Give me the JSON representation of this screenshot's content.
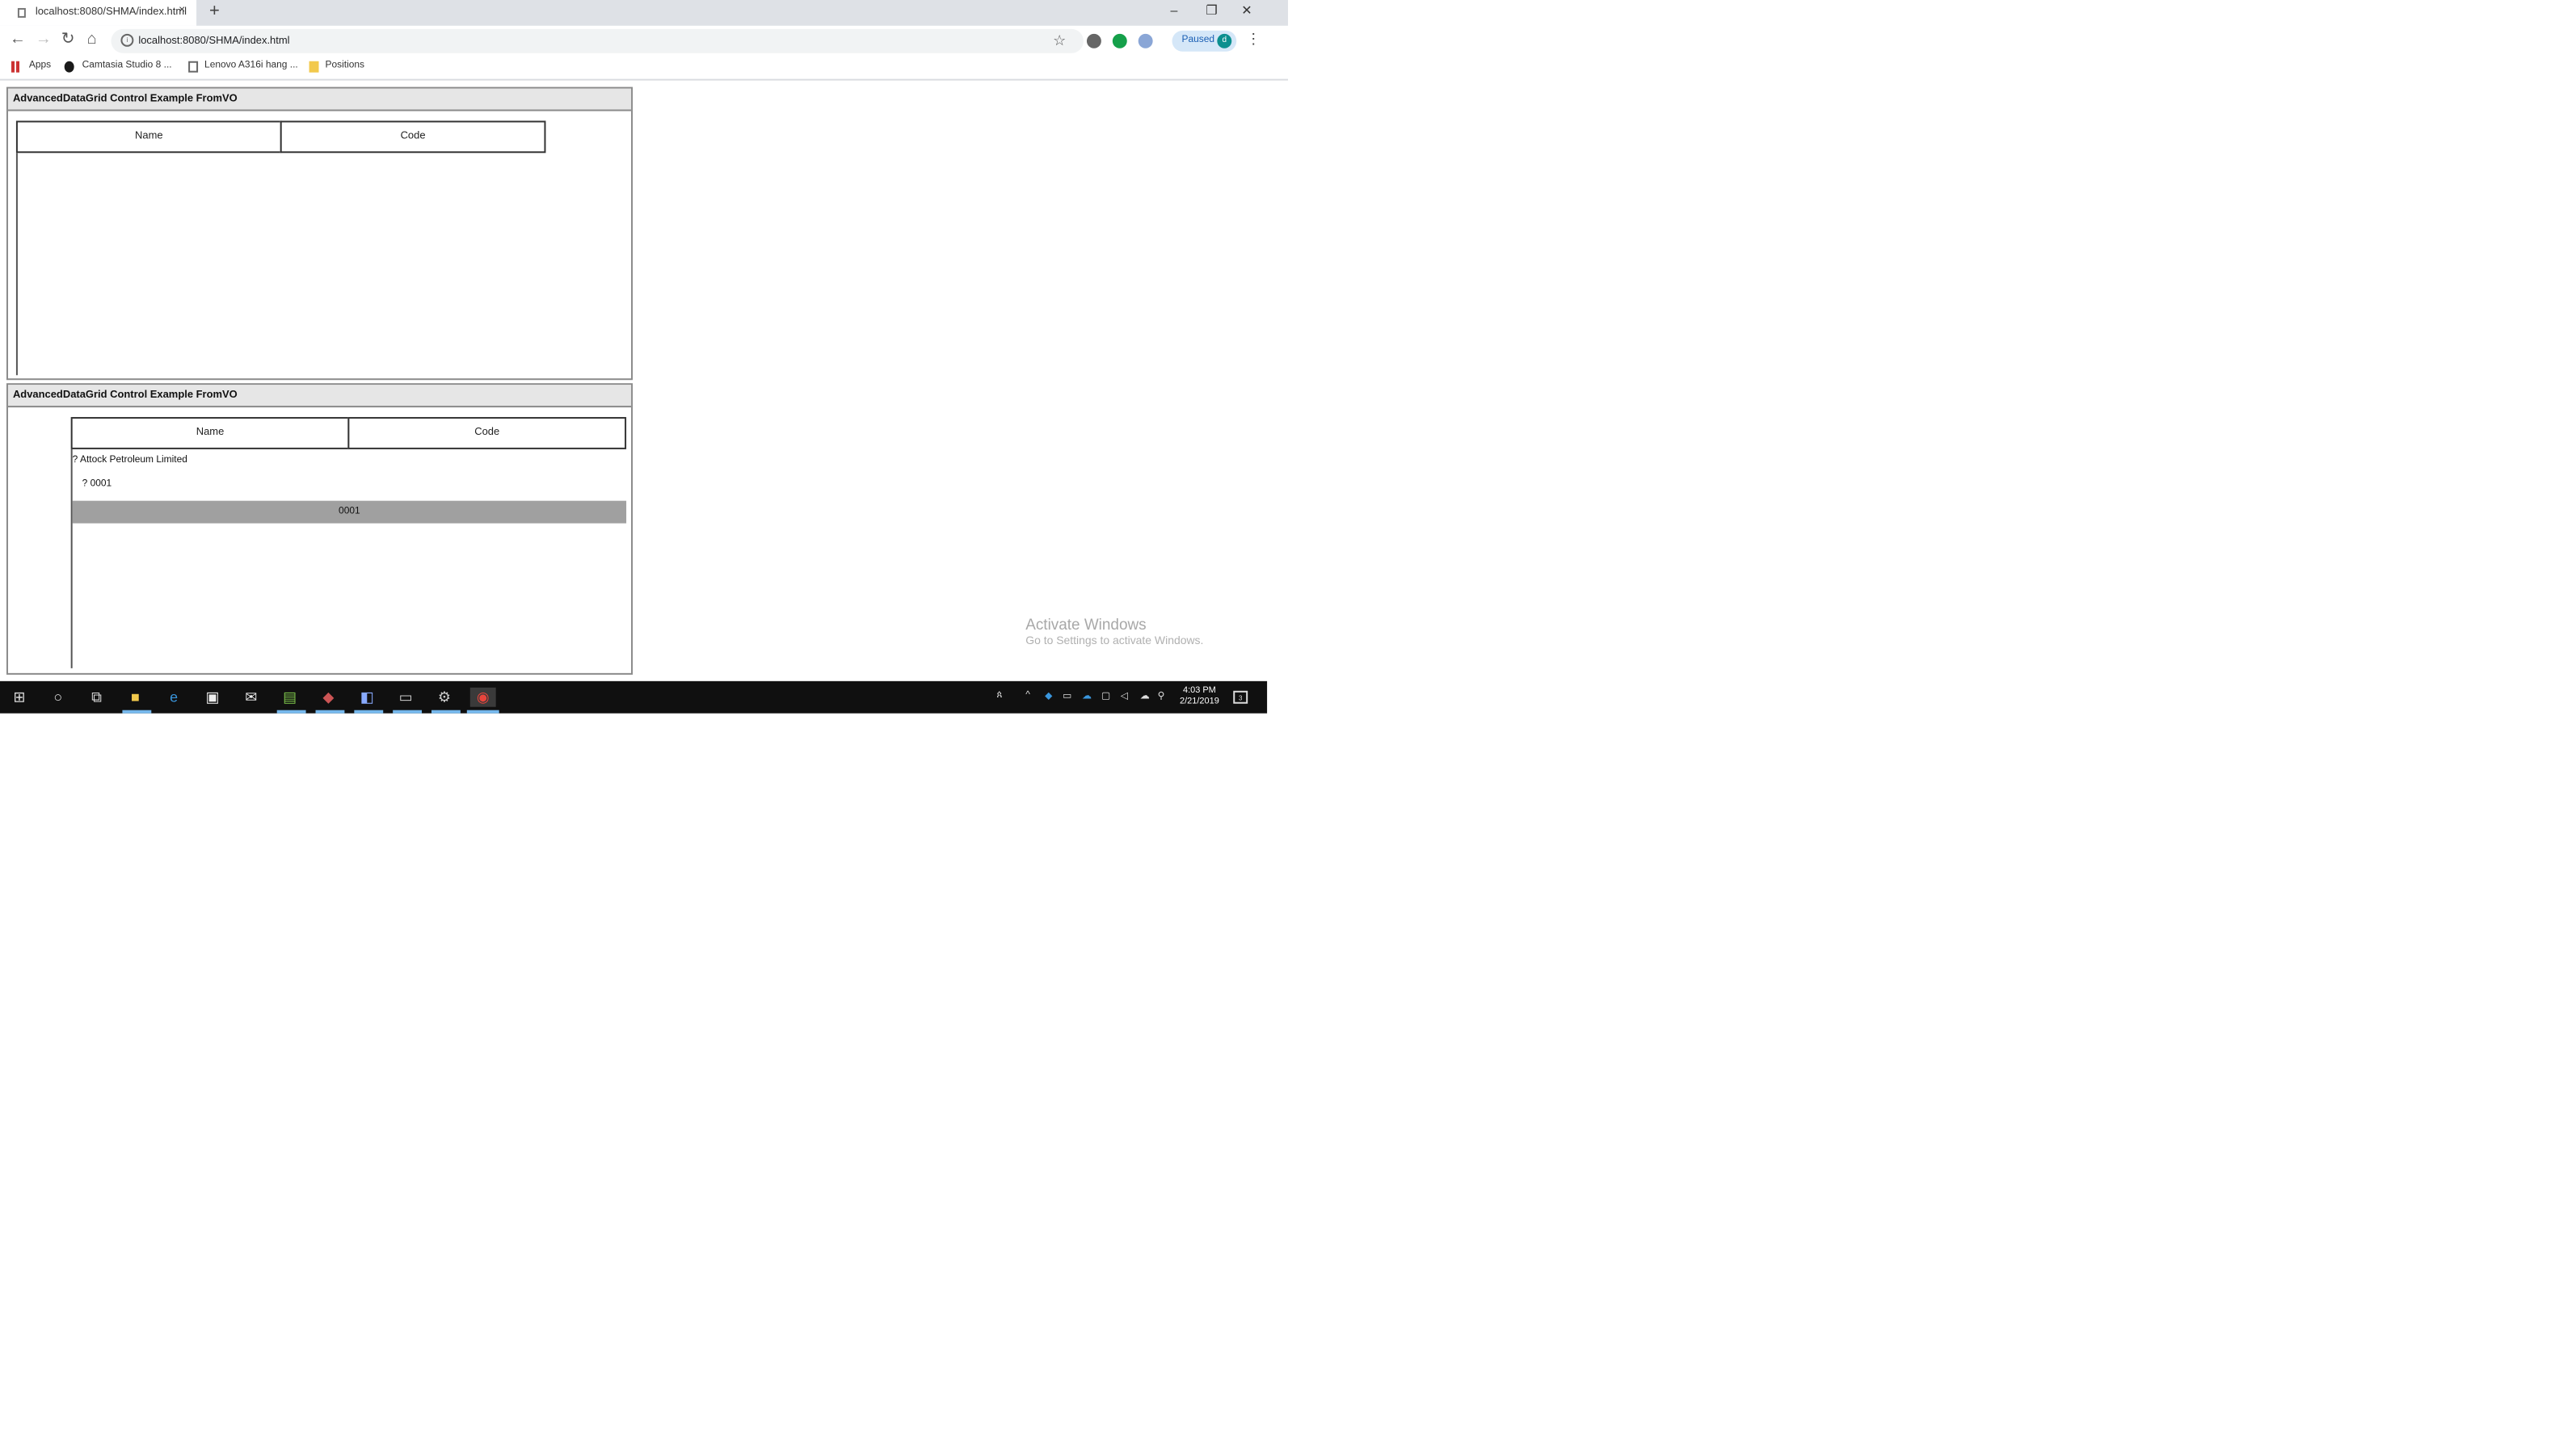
{
  "browser": {
    "tab_title": "localhost:8080/SHMA/index.html",
    "tab_close": "×",
    "new_tab": "+",
    "url": "localhost:8080/SHMA/index.html",
    "profile_status": "Paused",
    "profile_initial": "d",
    "window_controls": {
      "minimize": "–",
      "restore": "❐",
      "close": "✕"
    }
  },
  "bookmarks": [
    {
      "label": "Apps",
      "icon": "apps-grid-icon"
    },
    {
      "label": "Camtasia Studio 8 ...",
      "icon": "camtasia-icon"
    },
    {
      "label": "Lenovo A316i hang ...",
      "icon": "page-icon"
    },
    {
      "label": "Positions",
      "icon": "folder-icon"
    }
  ],
  "panel1": {
    "title": "AdvancedDataGrid Control Example FromVO",
    "columns": [
      "Name",
      "Code"
    ]
  },
  "panel2": {
    "title": "AdvancedDataGrid Control Example FromVO",
    "columns": [
      "Name",
      "Code"
    ],
    "rows": [
      {
        "text": "? Attock Petroleum Limited"
      },
      {
        "text": "? 0001"
      }
    ],
    "selected_row_code": "0001"
  },
  "watermark": {
    "title": "Activate Windows",
    "subtitle": "Go to Settings to activate Windows."
  },
  "taskbar": {
    "time": "4:03 PM",
    "date": "2/21/2019",
    "notification_count": "3"
  },
  "colors": {
    "panel_header_bg": "#e6e6e6",
    "selected_row_bg": "#a0a0a0",
    "taskbar_bg": "#101010",
    "paused_pill_bg": "#d5e7f8"
  }
}
